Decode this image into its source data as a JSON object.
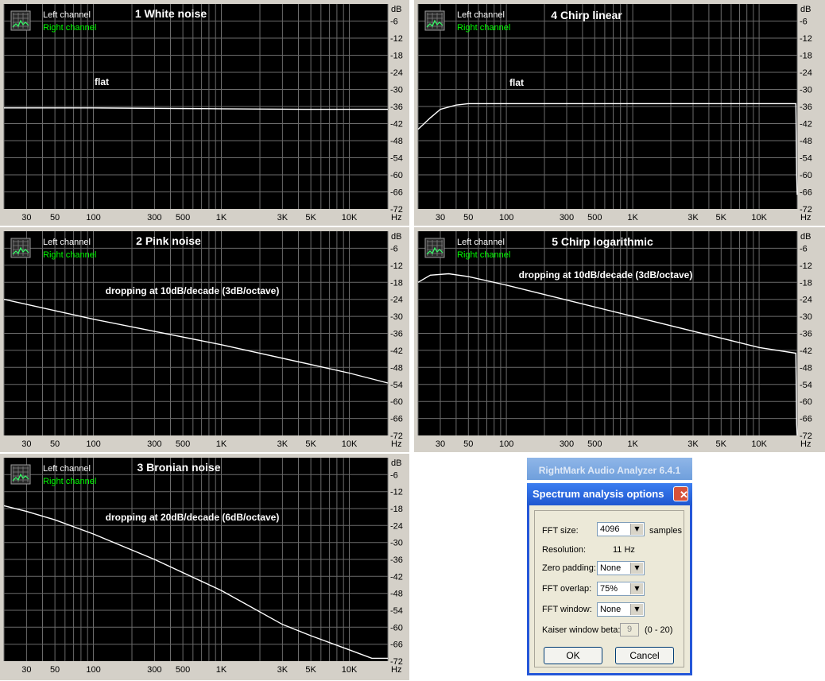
{
  "legend": {
    "left": "Left channel",
    "right": "Right channel"
  },
  "axis": {
    "unit": "dB",
    "ylabels": [
      "-6",
      "-12",
      "-18",
      "-24",
      "-30",
      "-36",
      "-42",
      "-48",
      "-54",
      "-60",
      "-66",
      "-72"
    ],
    "xlabels": [
      "30",
      "50",
      "100",
      "300",
      "500",
      "1K",
      "3K",
      "5K",
      "10K"
    ],
    "xunit": "Hz"
  },
  "colors": {
    "plot_bg": "#000000",
    "grid": "#6b6b6b",
    "trace": "#ffffff",
    "left_legend": "#ffffff",
    "right_legend": "#00ff00",
    "frame": "#d4d0c8"
  },
  "chart_data": [
    {
      "type": "line",
      "title": "1 White noise",
      "annotation": "flat",
      "xscale": "log",
      "xlim": [
        20,
        20000
      ],
      "ylim": [
        -72,
        0
      ],
      "series": [
        {
          "x": [
            20,
            100,
            1000,
            5000,
            20000
          ],
          "y": [
            -36.5,
            -36.5,
            -36.8,
            -37,
            -37
          ]
        }
      ]
    },
    {
      "type": "line",
      "title": "4 Chirp linear",
      "annotation": "flat",
      "xscale": "log",
      "xlim": [
        20,
        20000
      ],
      "ylim": [
        -72,
        0
      ],
      "series": [
        {
          "x": [
            20,
            25,
            30,
            40,
            50,
            1000,
            10000,
            19500,
            19800,
            20000
          ],
          "y": [
            -44,
            -40,
            -37,
            -35.5,
            -35,
            -35,
            -35,
            -35,
            -60,
            -67
          ]
        }
      ]
    },
    {
      "type": "line",
      "title": "2 Pink noise",
      "annotation": "dropping at 10dB/decade (3dB/octave)",
      "xscale": "log",
      "xlim": [
        20,
        20000
      ],
      "ylim": [
        -72,
        0
      ],
      "series": [
        {
          "x": [
            20,
            100,
            1000,
            10000,
            20000
          ],
          "y": [
            -24,
            -31,
            -40,
            -50,
            -53.5
          ]
        }
      ]
    },
    {
      "type": "line",
      "title": "5 Chirp logarithmic",
      "annotation": "dropping at 10dB/decade (3dB/octave)",
      "xscale": "log",
      "xlim": [
        20,
        20000
      ],
      "ylim": [
        -72,
        0
      ],
      "series": [
        {
          "x": [
            20,
            25,
            35,
            50,
            100,
            1000,
            10000,
            19500,
            19800,
            20000
          ],
          "y": [
            -18,
            -15.5,
            -15,
            -16,
            -19,
            -30,
            -41,
            -43,
            -68,
            -72
          ]
        }
      ]
    },
    {
      "type": "line",
      "title": "3 Bronian noise",
      "annotation": "dropping at 20dB/decade (6dB/octave)",
      "xscale": "log",
      "xlim": [
        20,
        20000
      ],
      "ylim": [
        -72,
        0
      ],
      "series": [
        {
          "x": [
            20,
            30,
            50,
            100,
            300,
            1000,
            3000,
            5000,
            10000,
            15000,
            20000
          ],
          "y": [
            -17,
            -19,
            -22,
            -27,
            -36,
            -47,
            -59,
            -63,
            -68,
            -71,
            -71
          ]
        }
      ]
    }
  ],
  "dialog": {
    "app_title": "RightMark Audio Analyzer 6.4.1",
    "title": "Spectrum analysis options",
    "fft_size_label": "FFT size:",
    "fft_size_value": "4096",
    "fft_size_unit": "samples",
    "resolution_label": "Resolution:",
    "resolution_value": "11 Hz",
    "zero_padding_label": "Zero padding:",
    "zero_padding_value": "None",
    "fft_overlap_label": "FFT overlap:",
    "fft_overlap_value": "75%",
    "fft_window_label": "FFT window:",
    "fft_window_value": "None",
    "kaiser_label": "Kaiser window beta:",
    "kaiser_value": "9",
    "kaiser_range": "(0 - 20)",
    "ok": "OK",
    "cancel": "Cancel"
  }
}
